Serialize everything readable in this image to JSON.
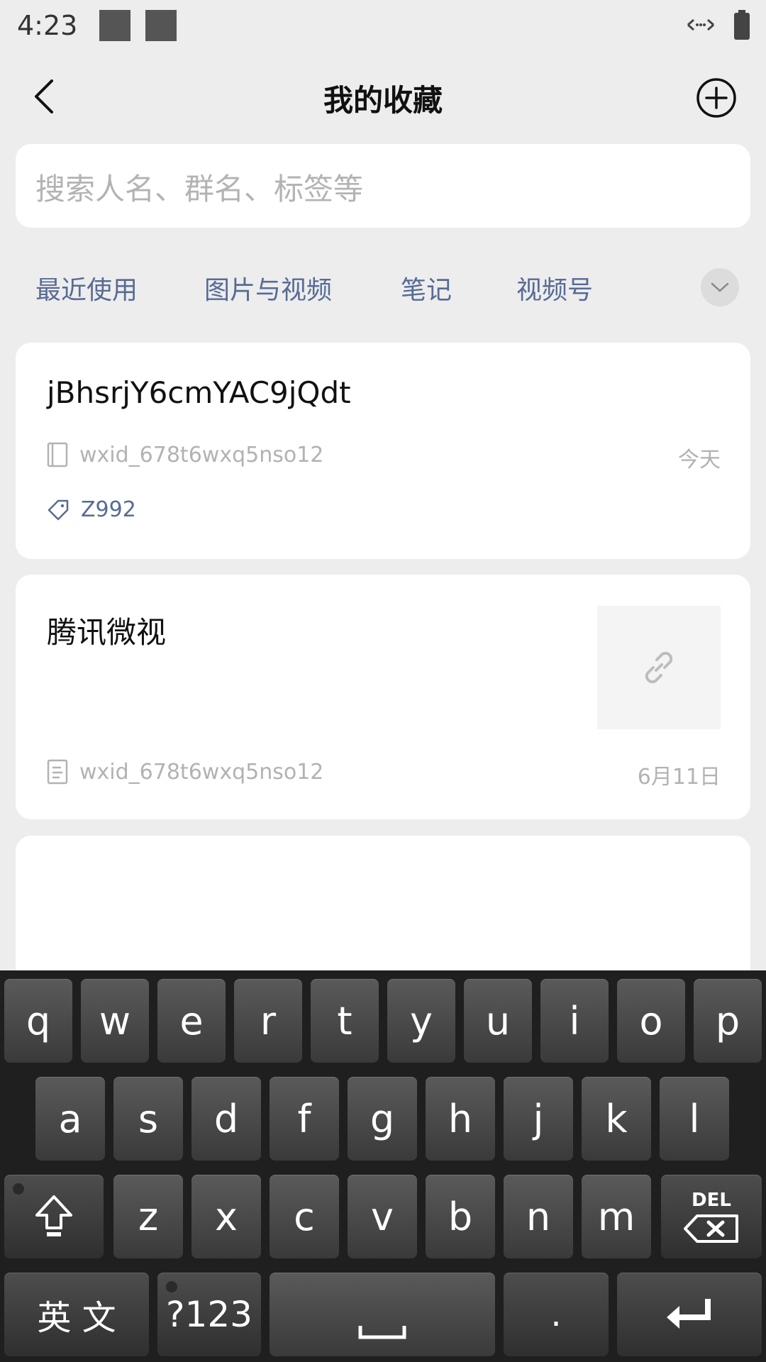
{
  "status_bar": {
    "time": "4:23",
    "icons": [
      "notification-square-icon",
      "notification-square-icon",
      "data-transfer-icon",
      "battery-icon"
    ]
  },
  "header": {
    "title": "我的收藏",
    "back_icon": "back-arrow-icon",
    "add_icon": "add-circle-icon"
  },
  "search": {
    "placeholder": "搜索人名、群名、标签等"
  },
  "tabs": [
    {
      "label": "最近使用"
    },
    {
      "label": "图片与视频"
    },
    {
      "label": "笔记"
    },
    {
      "label": "视频号"
    }
  ],
  "favorites": [
    {
      "title": "jBhsrjY6cmYAC9jQdt",
      "source": "wxid_678t6wxq5nso12",
      "date": "今天",
      "tag": "Z992",
      "type_icon": "note-icon"
    },
    {
      "title": "腾讯微视",
      "source": "wxid_678t6wxq5nso12",
      "date": "6月11日",
      "type_icon": "document-icon",
      "thumb_icon": "link-icon"
    }
  ],
  "keyboard": {
    "row1": [
      "q",
      "w",
      "e",
      "r",
      "t",
      "y",
      "u",
      "i",
      "o",
      "p"
    ],
    "row2": [
      "a",
      "s",
      "d",
      "f",
      "g",
      "h",
      "j",
      "k",
      "l"
    ],
    "row3": [
      "z",
      "x",
      "c",
      "v",
      "b",
      "n",
      "m"
    ],
    "del_label": "DEL",
    "lang_label": "英 文",
    "symbols_label": "?123",
    "period_label": "."
  },
  "colors": {
    "link_blue": "#576b95",
    "background": "#ededed",
    "placeholder": "#b3b3b3"
  }
}
